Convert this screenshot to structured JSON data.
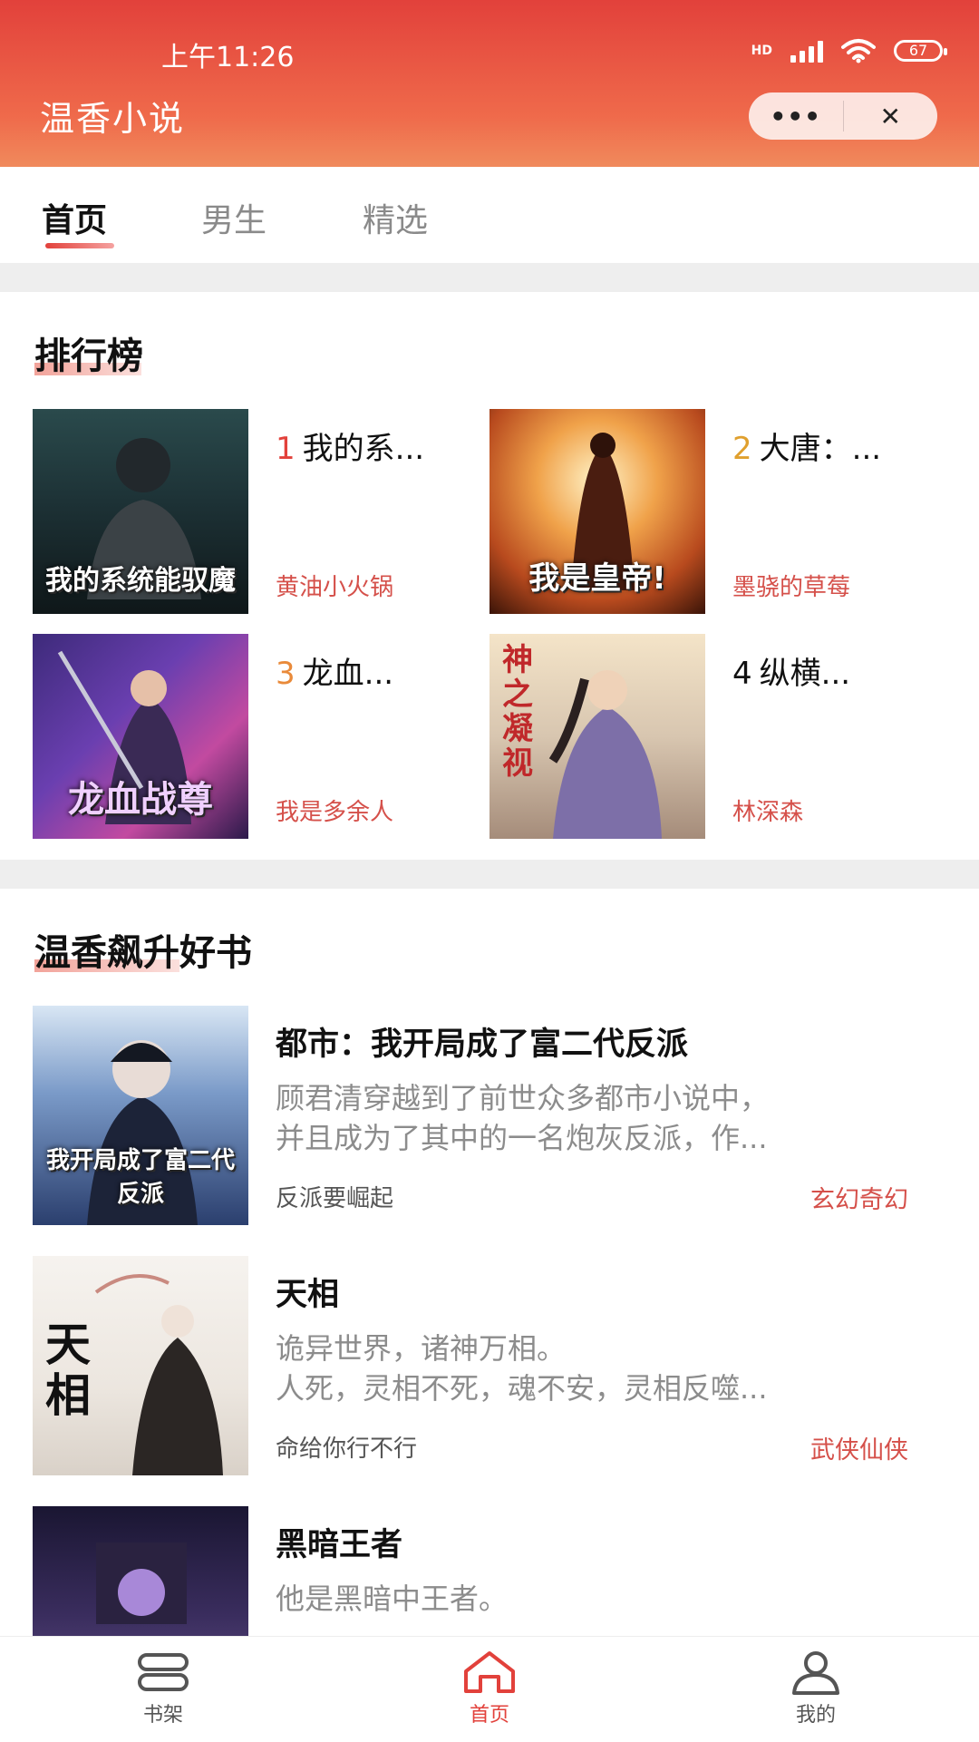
{
  "status_bar": {
    "time": "上午11:26",
    "network": "HD",
    "battery": "67"
  },
  "header": {
    "app_title": "温香小说",
    "more_label": "•••",
    "close_label": "✕"
  },
  "tabs": [
    {
      "label": "首页",
      "active": true
    },
    {
      "label": "男生",
      "active": false
    },
    {
      "label": "精选",
      "active": false
    }
  ],
  "ranking": {
    "title": "排行榜",
    "items": [
      {
        "rank": "1",
        "title": "我的系...",
        "author": "黄油小火锅",
        "cover_text": "我的系统能驭魔",
        "rank_color": "#e2413b"
      },
      {
        "rank": "2",
        "title": "大唐：...",
        "author": "墨骁的草莓",
        "cover_text": "我是皇帝!",
        "rank_color": "#e0a02e"
      },
      {
        "rank": "3",
        "title": "龙血...",
        "author": "我是多余人",
        "cover_text": "龙血战尊",
        "rank_color": "#e98a3a"
      },
      {
        "rank": "4",
        "title": "纵横...",
        "author": "林深森",
        "cover_text": "神之凝视",
        "rank_color": "#111111"
      }
    ]
  },
  "rising": {
    "title": "温香飙升好书",
    "books": [
      {
        "title": "都市：我开局成了富二代反派",
        "desc_line1": "顾君清穿越到了前世众多都市小说中，",
        "desc_line2": "并且成为了其中的一名炮灰反派，作...",
        "author": "反派要崛起",
        "genre": "玄幻奇幻",
        "cover_text": "我开局成了富二代反派"
      },
      {
        "title": "天相",
        "desc_line1": "诡异世界，诸神万相。",
        "desc_line2": "人死，灵相不死，魂不安，灵相反噬...",
        "author": "命给你行不行",
        "genre": "武侠仙侠",
        "cover_text": "天相"
      },
      {
        "title": "黑暗王者",
        "desc_line1": "他是黑暗中王者。",
        "desc_line2": "",
        "author": "",
        "genre": "",
        "cover_text": ""
      }
    ]
  },
  "bottom_nav": [
    {
      "label": "书架",
      "icon": "bookshelf-icon",
      "active": false
    },
    {
      "label": "首页",
      "icon": "home-icon",
      "active": true
    },
    {
      "label": "我的",
      "icon": "user-icon",
      "active": false
    }
  ],
  "colors": {
    "accent": "#e2413b",
    "header_start": "#e2413b",
    "header_end": "#f08a5c",
    "author_red": "#d5504a"
  }
}
